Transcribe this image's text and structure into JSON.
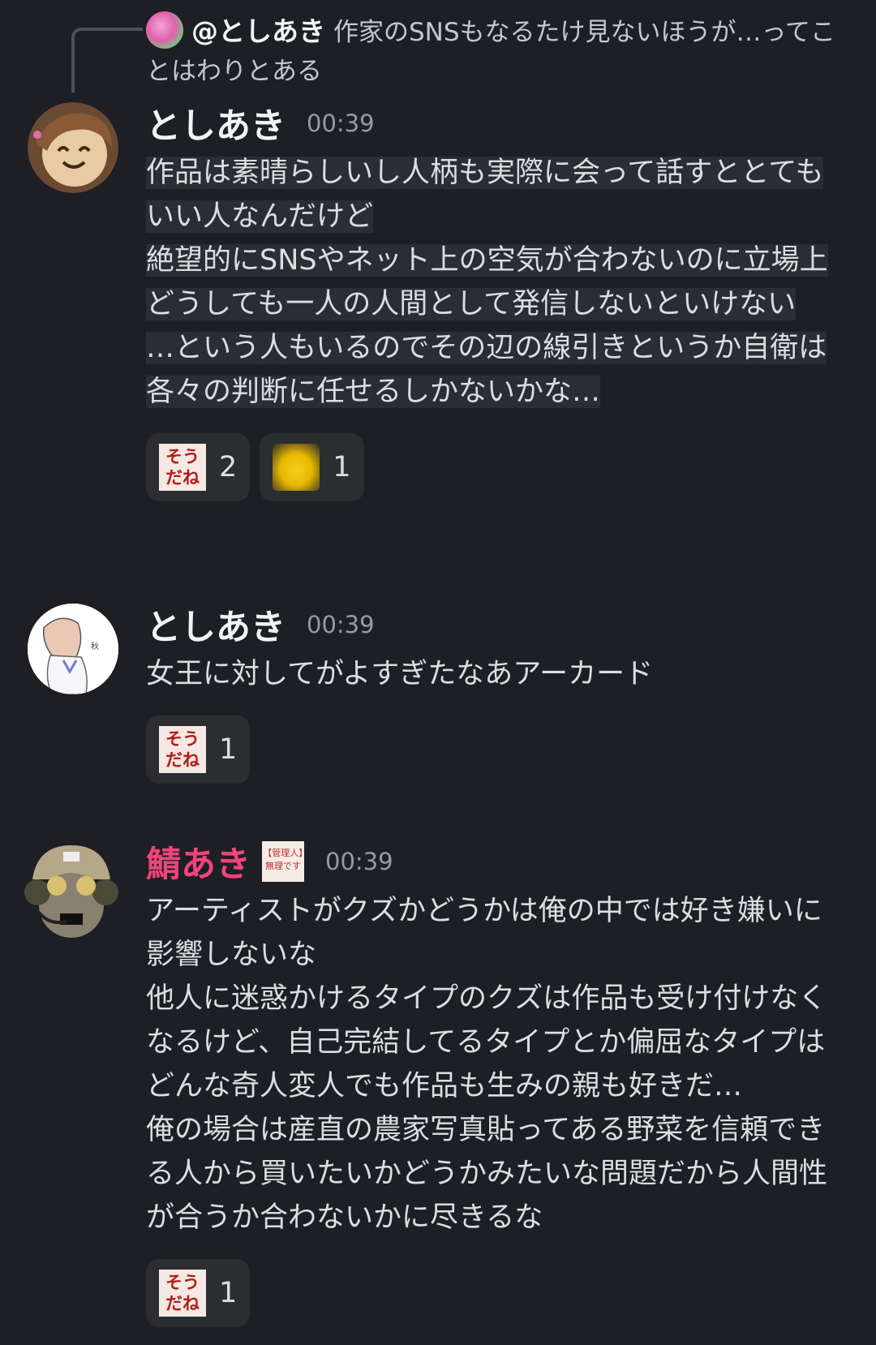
{
  "reply": {
    "name": "@としあき",
    "text": "作家のSNSもなるたけ見ないほうが…ってことはわりとある"
  },
  "messages": [
    {
      "name": "としあき",
      "time": "00:39",
      "lines": [
        "作品は素晴らしいし人柄も実際に会って話すととてもいい人なんだけど",
        "絶望的にSNSやネット上の空気が合わないのに立場上どうしても一人の人間として発信しないといけない",
        "…という人もいるのでその辺の線引きというか自衛は各々の判断に任せるしかないかな…"
      ],
      "reactions": [
        {
          "emoji_text": "そう だね",
          "count": "2"
        },
        {
          "emoji_icon": "pikachu-icon",
          "count": "1"
        }
      ]
    },
    {
      "name": "としあき",
      "time": "00:39",
      "lines": [
        "女王に対してがよすぎたなあアーカード"
      ],
      "reactions": [
        {
          "emoji_text": "そう だね",
          "count": "1"
        }
      ]
    },
    {
      "name": "鯖あき",
      "time": "00:39",
      "badge": "【管理人】無理です",
      "name_color": "#f0447c",
      "lines": [
        "アーティストがクズかどうかは俺の中では好き嫌いに影響しないな",
        "他人に迷惑かけるタイプのクズは作品も受け付けなくなるけど、自己完結してるタイプとか偏屈なタイプはどんな奇人変人でも作品も生みの親も好きだ…",
        "俺の場合は産直の農家写真貼ってある野菜を信頼できる人から買いたいかどうかみたいな問題だから人間性が合うか合わないかに尽きるな"
      ],
      "reactions": [
        {
          "emoji_text": "そう だね",
          "count": "1"
        }
      ]
    }
  ]
}
